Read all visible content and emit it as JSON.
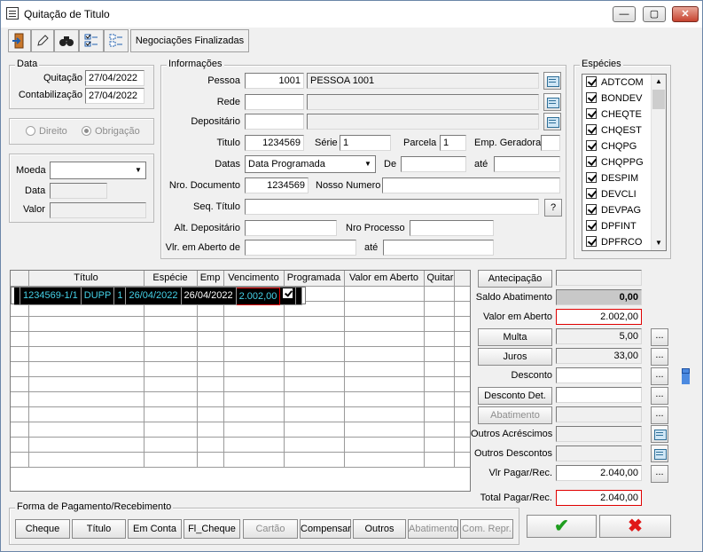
{
  "window": {
    "title": "Quitação de Titulo",
    "min": "—",
    "max": "▢",
    "close": "✕"
  },
  "toolbar": {
    "negociacoes": "Negociações Finalizadas"
  },
  "data_group": {
    "legend": "Data",
    "quitacao_label": "Quitação",
    "quitacao_value": "27/04/2022",
    "contabilizacao_label": "Contabilização",
    "contabilizacao_value": "27/04/2022"
  },
  "tipo": {
    "direito": "Direito",
    "obrigacao": "Obrigação"
  },
  "moeda": {
    "moeda_label": "Moeda",
    "data_label": "Data",
    "valor_label": "Valor"
  },
  "info": {
    "legend": "Informações",
    "pessoa_label": "Pessoa",
    "pessoa_code": "1001",
    "pessoa_name": "PESSOA 1001",
    "rede_label": "Rede",
    "depositario_label": "Depositário",
    "titulo_label": "Titulo",
    "titulo_value": "1234569",
    "serie_label": "Série",
    "serie_value": "1",
    "parcela_label": "Parcela",
    "parcela_value": "1",
    "emp_label": "Emp. Geradora",
    "datas_label": "Datas",
    "datas_value": "Data Programada",
    "de_label": "De",
    "ate_label": "até",
    "nrodoc_label": "Nro. Documento",
    "nrodoc_value": "1234569",
    "nosso_label": "Nosso Numero",
    "seq_label": "Seq. Título",
    "seq_help": "?",
    "altdep_label": "Alt. Depositário",
    "nroproc_label": "Nro Processo",
    "vlraberto_label": "Vlr. em Aberto de",
    "vlraberto_ate": "até"
  },
  "especies": {
    "legend": "Espécies",
    "items": [
      "ADTCOM",
      "BONDEV",
      "CHEQTE",
      "CHQEST",
      "CHQPG",
      "CHQPPG",
      "DESPIM",
      "DEVCLI",
      "DEVPAG",
      "DPFINT",
      "DPFRCO"
    ]
  },
  "grid": {
    "headers": [
      "Título",
      "Espécie",
      "Emp",
      "Vencimento",
      "Programada",
      "Valor em Aberto",
      "Quitar"
    ],
    "row": {
      "titulo": "1234569-1/1",
      "especie": "DUPP",
      "emp": "1",
      "venc": "26/04/2022",
      "prog": "26/04/2022",
      "valor": "2.002,00"
    }
  },
  "side": {
    "antecipacao": "Antecipação",
    "saldo_label": "Saldo Abatimento",
    "saldo_value": "0,00",
    "aberto_label": "Valor em Aberto",
    "aberto_value": "2.002,00",
    "multa": "Multa",
    "multa_value": "5,00",
    "juros": "Juros",
    "juros_value": "33,00",
    "desconto_label": "Desconto",
    "desconto_det": "Desconto Det.",
    "abatimento": "Abatimento",
    "acrescimos_label": "Outros Acréscimos",
    "descontos_label": "Outros Descontos",
    "vlrpagar_label": "Vlr Pagar/Rec.",
    "vlrpagar_value": "2.040,00",
    "total_label": "Total Pagar/Rec.",
    "total_value": "2.040,00",
    "dots": "...",
    "ok": "✔",
    "cancel": "✖"
  },
  "pagamento": {
    "legend": "Forma de Pagamento/Recebimento",
    "buttons": [
      "Cheque",
      "Título",
      "Em Conta",
      "Fl_Cheque",
      "Cartão",
      "Compensar",
      "Outros",
      "Abatimento",
      "Com. Repr."
    ]
  }
}
